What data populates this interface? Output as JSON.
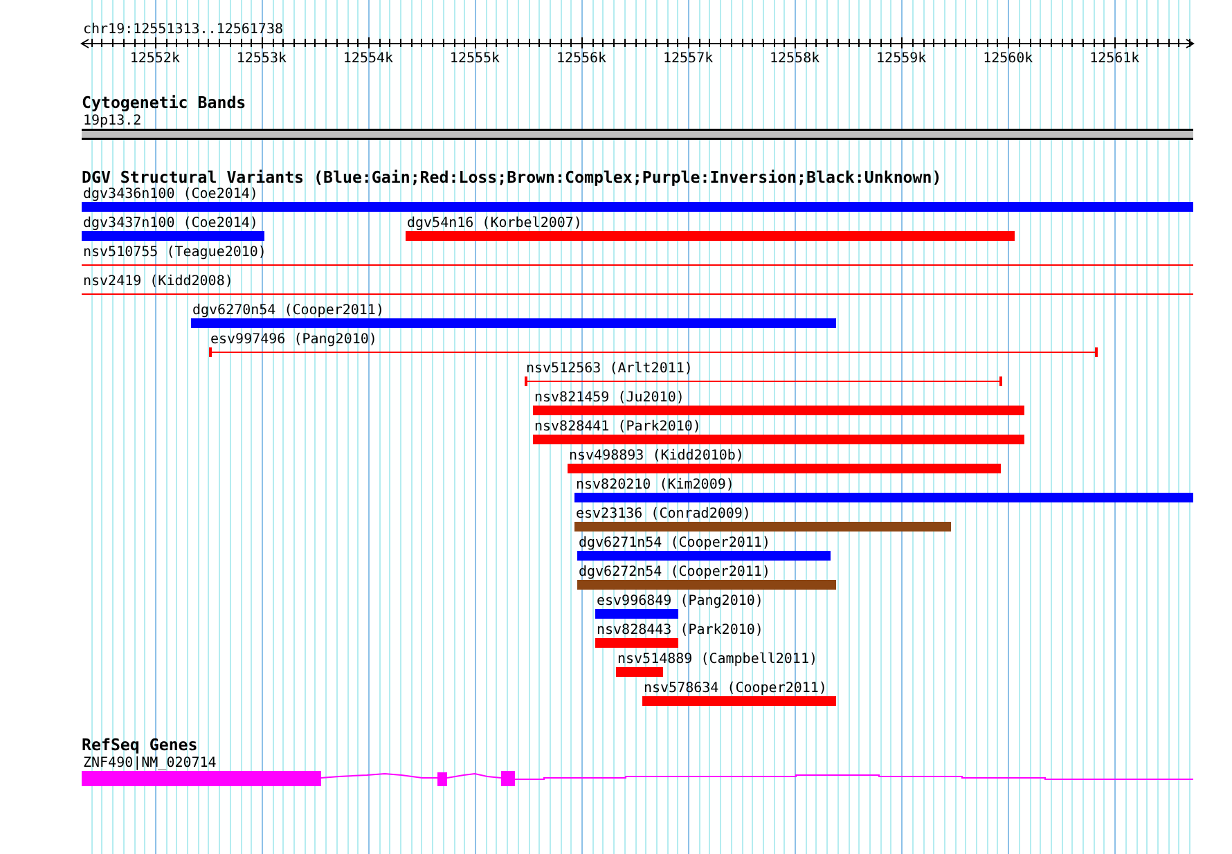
{
  "ruler": {
    "location": "chr19:12551313..12561738",
    "ticks": [
      "12552k",
      "12553k",
      "12554k",
      "12555k",
      "12556k",
      "12557k",
      "12558k",
      "12559k",
      "12560k",
      "12561k"
    ]
  },
  "cytogenetic_bands": {
    "title": "Cytogenetic Bands",
    "bands": [
      {
        "name": "19p13.2"
      }
    ]
  },
  "dgv_structural_variants": {
    "title": "DGV Structural Variants (Blue:Gain;Red:Loss;Brown:Complex;Purple:Inversion;Black:Unknown)",
    "rows": [
      {
        "features": [
          {
            "label": "dgv3436n100 (Coe2014)",
            "kind": "bar",
            "color": "#0000ff"
          }
        ]
      },
      {
        "features": [
          {
            "label": "dgv3437n100 (Coe2014)",
            "kind": "bar",
            "color": "#0000ff"
          },
          {
            "label": "dgv54n16 (Korbel2007)",
            "kind": "bar",
            "color": "#ff0000"
          }
        ]
      },
      {
        "features": [
          {
            "label": "nsv510755 (Teague2010)",
            "kind": "line",
            "color": "#ff0000"
          }
        ]
      },
      {
        "features": [
          {
            "label": "nsv2419 (Kidd2008)",
            "kind": "line",
            "color": "#ff0000"
          }
        ]
      },
      {
        "features": [
          {
            "label": "dgv6270n54 (Cooper2011)",
            "kind": "bar",
            "color": "#0000ff"
          }
        ]
      },
      {
        "features": [
          {
            "label": "esv997496 (Pang2010)",
            "kind": "line",
            "color": "#ff0000"
          }
        ]
      },
      {
        "features": [
          {
            "label": "nsv512563 (Arlt2011)",
            "kind": "line",
            "color": "#ff0000"
          }
        ]
      },
      {
        "features": [
          {
            "label": "nsv821459 (Ju2010)",
            "kind": "bar",
            "color": "#ff0000"
          }
        ]
      },
      {
        "features": [
          {
            "label": "nsv828441 (Park2010)",
            "kind": "bar",
            "color": "#ff0000"
          }
        ]
      },
      {
        "features": [
          {
            "label": "nsv498893 (Kidd2010b)",
            "kind": "bar",
            "color": "#ff0000"
          }
        ]
      },
      {
        "features": [
          {
            "label": "nsv820210 (Kim2009)",
            "kind": "bar",
            "color": "#0000ff"
          }
        ]
      },
      {
        "features": [
          {
            "label": "esv23136 (Conrad2009)",
            "kind": "bar",
            "color": "#8b4513"
          }
        ]
      },
      {
        "features": [
          {
            "label": "dgv6271n54 (Cooper2011)",
            "kind": "bar",
            "color": "#0000ff"
          }
        ]
      },
      {
        "features": [
          {
            "label": "dgv6272n54 (Cooper2011)",
            "kind": "bar",
            "color": "#8b4513"
          }
        ]
      },
      {
        "features": [
          {
            "label": "esv996849 (Pang2010)",
            "kind": "bar",
            "color": "#0000ff"
          }
        ]
      },
      {
        "features": [
          {
            "label": "nsv828443 (Park2010)",
            "kind": "bar",
            "color": "#ff0000"
          }
        ]
      },
      {
        "features": [
          {
            "label": "nsv514889 (Campbell2011)",
            "kind": "bar",
            "color": "#ff0000"
          }
        ]
      },
      {
        "features": [
          {
            "label": "nsv578634 (Cooper2011)",
            "kind": "bar",
            "color": "#ff0000"
          }
        ]
      }
    ]
  },
  "refseq_genes": {
    "title": "RefSeq Genes",
    "genes": [
      {
        "label": "ZNF490|NM_020714"
      }
    ]
  }
}
